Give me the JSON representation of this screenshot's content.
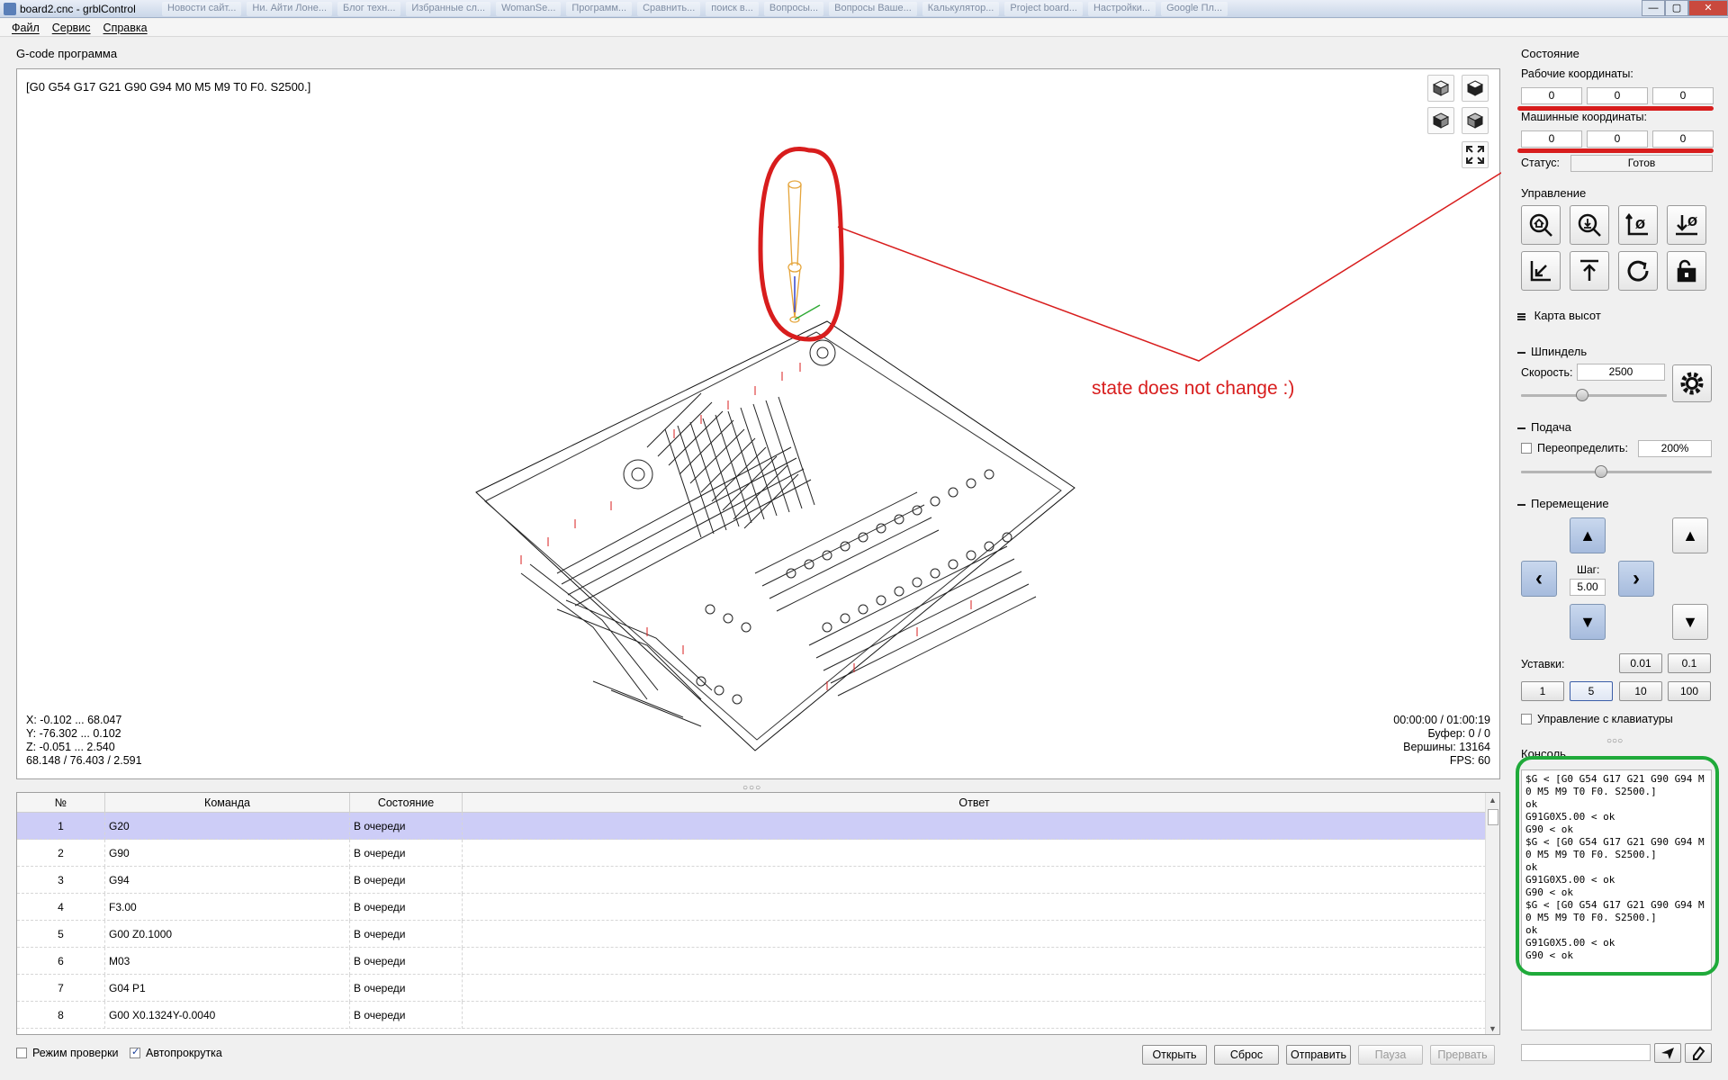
{
  "window": {
    "title": "board2.cnc - grblControl",
    "browser_tabs": [
      "Новости сайт...",
      "Ни. Айти Лоне...",
      "Блог техн...",
      "Избранные сл...",
      "WomanSe...",
      "Программ...",
      "Сравнить...",
      "поиск в...",
      "Вопросы...",
      "Вопросы Ваше...",
      "Калькулятор...",
      "Project board...",
      "Настройки...",
      "Google Пл..."
    ],
    "minimize": "—",
    "maximize": "▢",
    "close": "✕"
  },
  "menu": [
    "Файл",
    "Сервис",
    "Справка"
  ],
  "gcode": {
    "group_title": "G-code программа",
    "state_line": "[G0 G54 G17 G21 G90 G94 M0 M5 M9 T0 F0. S2500.]",
    "bounds": [
      "X: -0.102 ... 68.047",
      "Y: -76.302 ... 0.102",
      "Z: -0.051 ... 2.540",
      "68.148 / 76.403 / 2.591"
    ],
    "stats": [
      "00:00:00 / 01:00:19",
      "Буфер: 0 / 0",
      "Вершины: 13164",
      "FPS: 60"
    ],
    "annotation": "state does not change :)"
  },
  "table": {
    "headers": [
      "№",
      "Команда",
      "Состояние",
      "Ответ"
    ],
    "rows": [
      {
        "num": "1",
        "cmd": "G20",
        "state": "В очереди",
        "resp": ""
      },
      {
        "num": "2",
        "cmd": "G90",
        "state": "В очереди",
        "resp": ""
      },
      {
        "num": "3",
        "cmd": "G94",
        "state": "В очереди",
        "resp": ""
      },
      {
        "num": "4",
        "cmd": "F3.00",
        "state": "В очереди",
        "resp": ""
      },
      {
        "num": "5",
        "cmd": "G00 Z0.1000",
        "state": "В очереди",
        "resp": ""
      },
      {
        "num": "6",
        "cmd": "M03",
        "state": "В очереди",
        "resp": ""
      },
      {
        "num": "7",
        "cmd": "G04 P1",
        "state": "В очереди",
        "resp": ""
      },
      {
        "num": "8",
        "cmd": "G00 X0.1324Y-0.0040",
        "state": "В очереди",
        "resp": ""
      }
    ]
  },
  "bottom": {
    "check_mode": "Режим проверки",
    "autoscroll": "Автопрокрутка",
    "open": "Открыть",
    "reset": "Сброс",
    "send": "Отправить",
    "pause": "Пауза",
    "abort": "Прервать"
  },
  "state": {
    "group_title": "Состояние",
    "work_label": "Рабочие координаты:",
    "work": [
      "0",
      "0",
      "0"
    ],
    "machine_label": "Машинные координаты:",
    "machine": [
      "0",
      "0",
      "0"
    ],
    "status_label": "Статус:",
    "status_value": "Готов"
  },
  "control": {
    "group_title": "Управление",
    "buttons": [
      "home-icon",
      "zoom-probe-icon",
      "zero-xy-icon",
      "zero-z-icon",
      "restore-origin-icon",
      "safe-position-icon",
      "reset-icon",
      "unlock-icon"
    ]
  },
  "heightmap": {
    "title": "Карта высот"
  },
  "spindle": {
    "title": "Шпиндель",
    "speed_label": "Скорость:",
    "speed_value": "2500",
    "slider": 0.42
  },
  "feed": {
    "title": "Подача",
    "override_label": "Переопределить:",
    "override_value": "200%",
    "slider": 0.42
  },
  "jog": {
    "title": "Перемещение",
    "step_label": "Шаг:",
    "step_value": "5.00",
    "presets_label": "Уставки:",
    "presets_top": [
      "0.01",
      "0.1"
    ],
    "presets_bottom": [
      "1",
      "5",
      "10",
      "100"
    ],
    "keyboard": "Управление с клавиатуры"
  },
  "console": {
    "title": "Консоль",
    "lines": "$G < [G0 G54 G17 G21 G90 G94 M0 M5 M9 T0 F0. S2500.]\nok\nG91G0X5.00 < ok\nG90 < ok\n$G < [G0 G54 G17 G21 G90 G94 M0 M5 M9 T0 F0. S2500.]\nok\nG91G0X5.00 < ok\nG90 < ok\n$G < [G0 G54 G17 G21 G90 G94 M0 M5 M9 T0 F0. S2500.]\nok\nG91G0X5.00 < ok\nG90 < ok",
    "input_value": ""
  },
  "colors": {
    "annotation_red": "#d81d1d",
    "annotation_green": "#1faa3a",
    "selection": "#cdcdf7",
    "jog_blue": "#a6bbdd"
  }
}
